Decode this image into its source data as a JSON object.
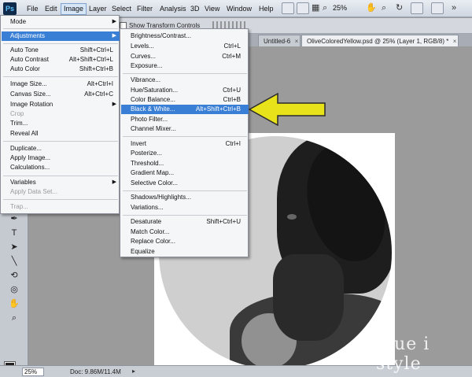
{
  "app": {
    "logo": "Ps"
  },
  "menubar": {
    "items": [
      "File",
      "Edit",
      "Image",
      "Layer",
      "Select",
      "Filter",
      "Analysis",
      "3D",
      "View",
      "Window",
      "Help"
    ],
    "zoom": "25%"
  },
  "options": {
    "show_transform_controls": "Show Transform Controls"
  },
  "tabs": [
    {
      "label": "Untitled-6"
    },
    {
      "label": "OliveColoredYellow.psd @ 25% (Layer 1, RGB/8) *"
    }
  ],
  "image_menu": {
    "items": [
      {
        "label": "Mode",
        "shortcut": "",
        "submenu": true,
        "disabled": false
      },
      {
        "label": "Adjustments",
        "shortcut": "",
        "submenu": true,
        "disabled": false,
        "highlight": true
      },
      {
        "label": "Auto Tone",
        "shortcut": "Shift+Ctrl+L",
        "disabled": false
      },
      {
        "label": "Auto Contrast",
        "shortcut": "Alt+Shift+Ctrl+L",
        "disabled": false
      },
      {
        "label": "Auto Color",
        "shortcut": "Shift+Ctrl+B",
        "disabled": false
      },
      {
        "label": "Image Size...",
        "shortcut": "Alt+Ctrl+I",
        "disabled": false
      },
      {
        "label": "Canvas Size...",
        "shortcut": "Alt+Ctrl+C",
        "disabled": false
      },
      {
        "label": "Image Rotation",
        "shortcut": "",
        "submenu": true,
        "disabled": false
      },
      {
        "label": "Crop",
        "shortcut": "",
        "disabled": true
      },
      {
        "label": "Trim...",
        "shortcut": "",
        "disabled": false
      },
      {
        "label": "Reveal All",
        "shortcut": "",
        "disabled": false
      },
      {
        "label": "Duplicate...",
        "shortcut": "",
        "disabled": false
      },
      {
        "label": "Apply Image...",
        "shortcut": "",
        "disabled": false
      },
      {
        "label": "Calculations...",
        "shortcut": "",
        "disabled": false
      },
      {
        "label": "Variables",
        "shortcut": "",
        "submenu": true,
        "disabled": false
      },
      {
        "label": "Apply Data Set...",
        "shortcut": "",
        "disabled": true
      },
      {
        "label": "Trap...",
        "shortcut": "",
        "disabled": true
      }
    ]
  },
  "adjustments_menu": {
    "items": [
      {
        "label": "Brightness/Contrast...",
        "shortcut": ""
      },
      {
        "label": "Levels...",
        "shortcut": "Ctrl+L"
      },
      {
        "label": "Curves...",
        "shortcut": "Ctrl+M"
      },
      {
        "label": "Exposure...",
        "shortcut": ""
      },
      {
        "label": "Vibrance...",
        "shortcut": ""
      },
      {
        "label": "Hue/Saturation...",
        "shortcut": "Ctrl+U"
      },
      {
        "label": "Color Balance...",
        "shortcut": "Ctrl+B"
      },
      {
        "label": "Black & White...",
        "shortcut": "Alt+Shift+Ctrl+B",
        "highlight": true
      },
      {
        "label": "Photo Filter...",
        "shortcut": ""
      },
      {
        "label": "Channel Mixer...",
        "shortcut": ""
      },
      {
        "label": "Invert",
        "shortcut": "Ctrl+I"
      },
      {
        "label": "Posterize...",
        "shortcut": ""
      },
      {
        "label": "Threshold...",
        "shortcut": ""
      },
      {
        "label": "Gradient Map...",
        "shortcut": ""
      },
      {
        "label": "Selective Color...",
        "shortcut": ""
      },
      {
        "label": "Shadows/Highlights...",
        "shortcut": ""
      },
      {
        "label": "Variations...",
        "shortcut": ""
      },
      {
        "label": "Desaturate",
        "shortcut": "Shift+Ctrl+U"
      },
      {
        "label": "Match Color...",
        "shortcut": ""
      },
      {
        "label": "Replace Color...",
        "shortcut": ""
      },
      {
        "label": "Equalize",
        "shortcut": ""
      }
    ]
  },
  "status": {
    "zoom": "25%",
    "doc": "Doc: 9.86M/11.4M"
  },
  "watermark": "blue i style",
  "colors": {
    "highlight": "#3a7fd6",
    "arrow": "#e8e21a",
    "background_swatch": "#1e8fd0"
  }
}
